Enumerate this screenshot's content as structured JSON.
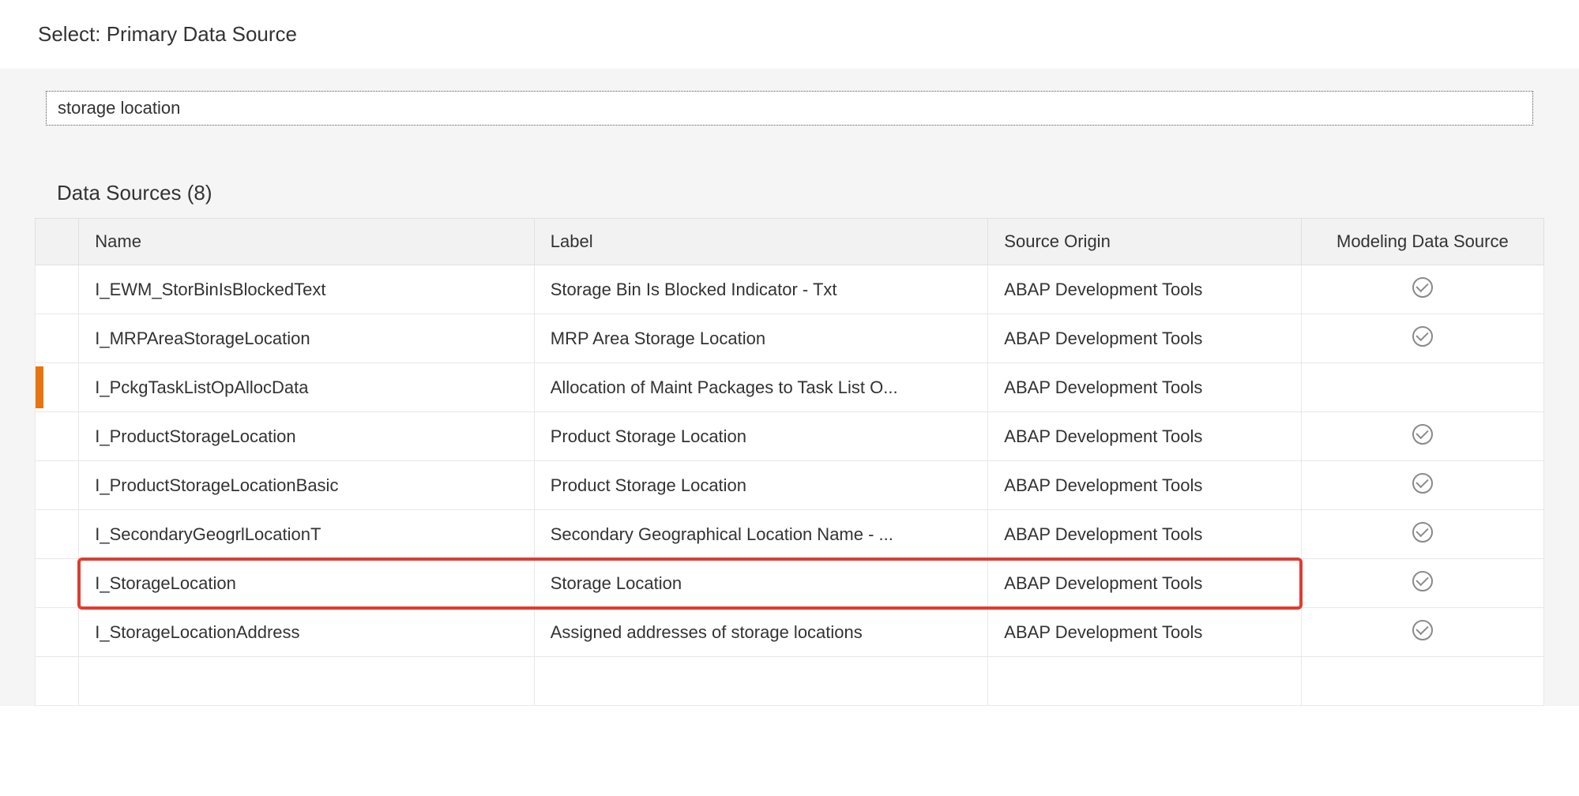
{
  "page": {
    "title": "Select: Primary Data Source"
  },
  "search": {
    "value": "storage location"
  },
  "section": {
    "title": "Data Sources (8)"
  },
  "table": {
    "headers": {
      "name": "Name",
      "label": "Label",
      "origin": "Source Origin",
      "model": "Modeling Data Source"
    },
    "rows": [
      {
        "name": "I_EWM_StorBinIsBlockedText",
        "label": "Storage Bin Is Blocked Indicator - Txt",
        "origin": "ABAP Development Tools",
        "model": true,
        "highlighted": false,
        "boxed": false
      },
      {
        "name": "I_MRPAreaStorageLocation",
        "label": "MRP Area Storage Location",
        "origin": "ABAP Development Tools",
        "model": true,
        "highlighted": false,
        "boxed": false
      },
      {
        "name": "I_PckgTaskListOpAllocData",
        "label": "Allocation of Maint Packages to Task List O...",
        "origin": "ABAP Development Tools",
        "model": false,
        "highlighted": true,
        "boxed": false
      },
      {
        "name": "I_ProductStorageLocation",
        "label": "Product Storage Location",
        "origin": "ABAP Development Tools",
        "model": true,
        "highlighted": false,
        "boxed": false
      },
      {
        "name": "I_ProductStorageLocationBasic",
        "label": "Product Storage Location",
        "origin": "ABAP Development Tools",
        "model": true,
        "highlighted": false,
        "boxed": false
      },
      {
        "name": "I_SecondaryGeogrlLocationT",
        "label": "Secondary Geographical Location Name - ...",
        "origin": "ABAP Development Tools",
        "model": true,
        "highlighted": false,
        "boxed": false
      },
      {
        "name": "I_StorageLocation",
        "label": "Storage Location",
        "origin": "ABAP Development Tools",
        "model": true,
        "highlighted": false,
        "boxed": true
      },
      {
        "name": "I_StorageLocationAddress",
        "label": "Assigned addresses of storage locations",
        "origin": "ABAP Development Tools",
        "model": true,
        "highlighted": false,
        "boxed": false
      }
    ]
  }
}
